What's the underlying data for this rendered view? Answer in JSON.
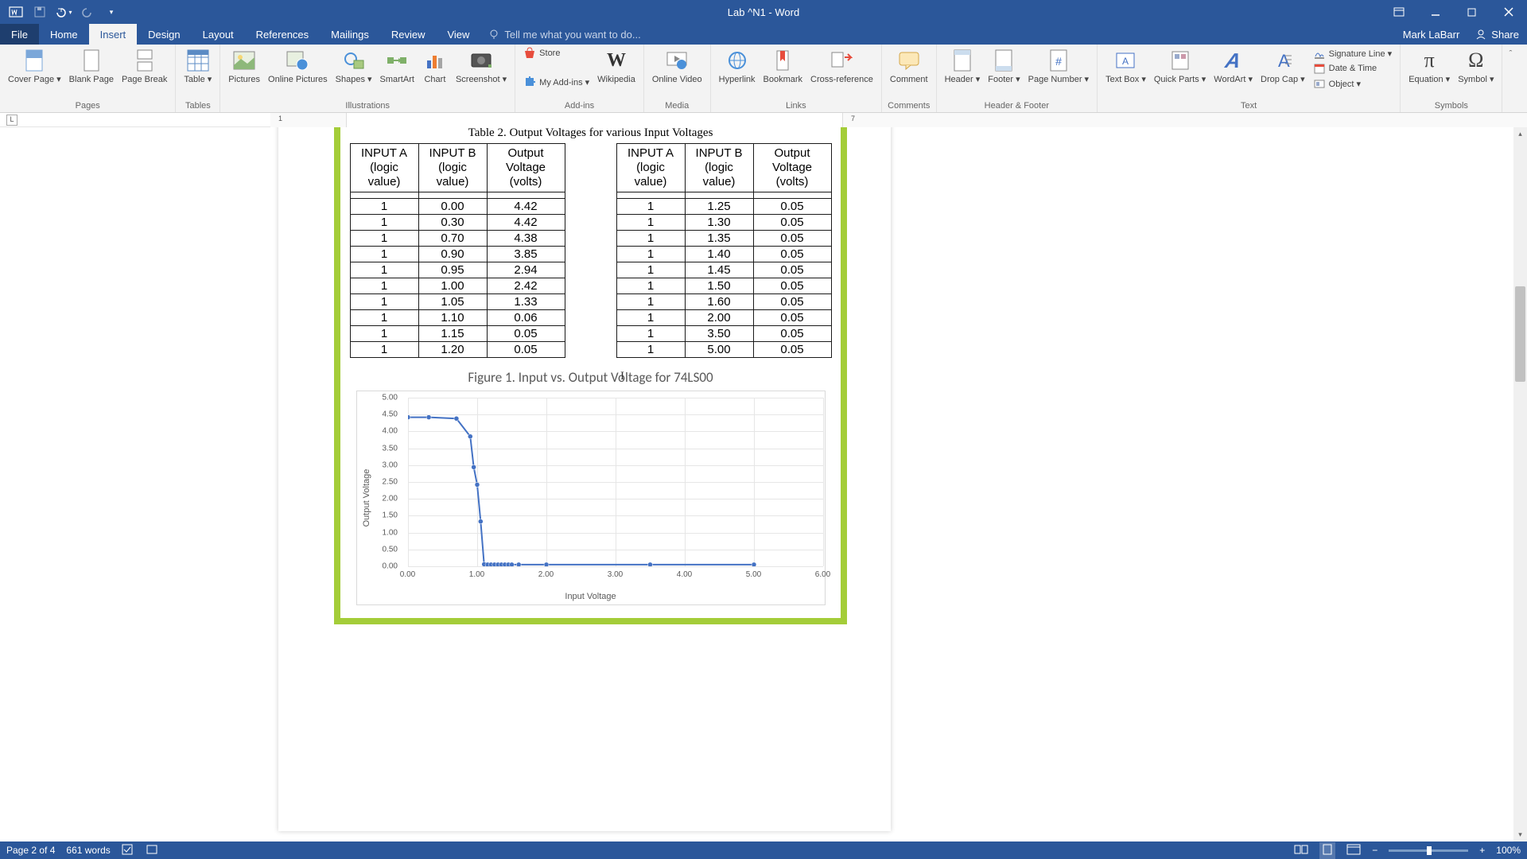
{
  "app": {
    "title": "Lab ^N1 - Word",
    "user": "Mark LaBarr",
    "share": "Share"
  },
  "tabs": [
    "File",
    "Home",
    "Insert",
    "Design",
    "Layout",
    "References",
    "Mailings",
    "Review",
    "View"
  ],
  "tellme": "Tell me what you want to do...",
  "ribbon": {
    "groups": {
      "pages": {
        "label": "Pages",
        "items": [
          "Cover Page ▾",
          "Blank Page",
          "Page Break"
        ]
      },
      "tables": {
        "label": "Tables",
        "item": "Table ▾"
      },
      "illus": {
        "label": "Illustrations",
        "items": [
          "Pictures",
          "Online Pictures",
          "Shapes ▾",
          "SmartArt",
          "Chart",
          "Screenshot ▾"
        ]
      },
      "addins": {
        "label": "Add-ins",
        "store": "Store",
        "myaddins": "My Add-ins ▾",
        "wikipedia": "Wikipedia"
      },
      "media": {
        "label": "Media",
        "item": "Online Video"
      },
      "links": {
        "label": "Links",
        "items": [
          "Hyperlink",
          "Bookmark",
          "Cross-reference"
        ]
      },
      "comments": {
        "label": "Comments",
        "item": "Comment"
      },
      "hf": {
        "label": "Header & Footer",
        "items": [
          "Header ▾",
          "Footer ▾",
          "Page Number ▾"
        ]
      },
      "text": {
        "label": "Text",
        "items": [
          "Text Box ▾",
          "Quick Parts ▾",
          "WordArt ▾",
          "Drop Cap ▾"
        ],
        "small": [
          "Signature Line ▾",
          "Date & Time",
          "Object ▾"
        ]
      },
      "symbols": {
        "label": "Symbols",
        "items": [
          "Equation ▾",
          "Symbol ▾"
        ]
      }
    }
  },
  "doc": {
    "table_caption": "Table 2. Output Voltages for various Input Voltages",
    "headers": {
      "a": "INPUT A",
      "a2": "(logic value)",
      "b": "INPUT B",
      "b2": "(logic value)",
      "v": "Output Voltage",
      "v2": "(volts)"
    },
    "left_rows": [
      [
        "1",
        "0.00",
        "4.42"
      ],
      [
        "1",
        "0.30",
        "4.42"
      ],
      [
        "1",
        "0.70",
        "4.38"
      ],
      [
        "1",
        "0.90",
        "3.85"
      ],
      [
        "1",
        "0.95",
        "2.94"
      ],
      [
        "1",
        "1.00",
        "2.42"
      ],
      [
        "1",
        "1.05",
        "1.33"
      ],
      [
        "1",
        "1.10",
        "0.06"
      ],
      [
        "1",
        "1.15",
        "0.05"
      ],
      [
        "1",
        "1.20",
        "0.05"
      ]
    ],
    "right_rows": [
      [
        "1",
        "1.25",
        "0.05"
      ],
      [
        "1",
        "1.30",
        "0.05"
      ],
      [
        "1",
        "1.35",
        "0.05"
      ],
      [
        "1",
        "1.40",
        "0.05"
      ],
      [
        "1",
        "1.45",
        "0.05"
      ],
      [
        "1",
        "1.50",
        "0.05"
      ],
      [
        "1",
        "1.60",
        "0.05"
      ],
      [
        "1",
        "2.00",
        "0.05"
      ],
      [
        "1",
        "3.50",
        "0.05"
      ],
      [
        "1",
        "5.00",
        "0.05"
      ]
    ],
    "figure_caption": "Figure 1. Input vs. Output Voltage for 74LS00"
  },
  "chart_data": {
    "type": "line",
    "title": "Figure 1. Input vs. Output Voltage for 74LS00",
    "xlabel": "Input Voltage",
    "ylabel": "Output Voltage",
    "xlim": [
      0.0,
      6.0
    ],
    "ylim": [
      0.0,
      5.0
    ],
    "xticks": [
      0.0,
      1.0,
      2.0,
      3.0,
      4.0,
      5.0,
      6.0
    ],
    "yticks": [
      0.0,
      0.5,
      1.0,
      1.5,
      2.0,
      2.5,
      3.0,
      3.5,
      4.0,
      4.5,
      5.0
    ],
    "x": [
      0.0,
      0.3,
      0.7,
      0.9,
      0.95,
      1.0,
      1.05,
      1.1,
      1.15,
      1.2,
      1.25,
      1.3,
      1.35,
      1.4,
      1.45,
      1.5,
      1.6,
      2.0,
      3.5,
      5.0
    ],
    "y": [
      4.42,
      4.42,
      4.38,
      3.85,
      2.94,
      2.42,
      1.33,
      0.06,
      0.05,
      0.05,
      0.05,
      0.05,
      0.05,
      0.05,
      0.05,
      0.05,
      0.05,
      0.05,
      0.05,
      0.05
    ]
  },
  "status": {
    "page": "Page 2 of 4",
    "words": "661 words",
    "zoom": "100%"
  }
}
